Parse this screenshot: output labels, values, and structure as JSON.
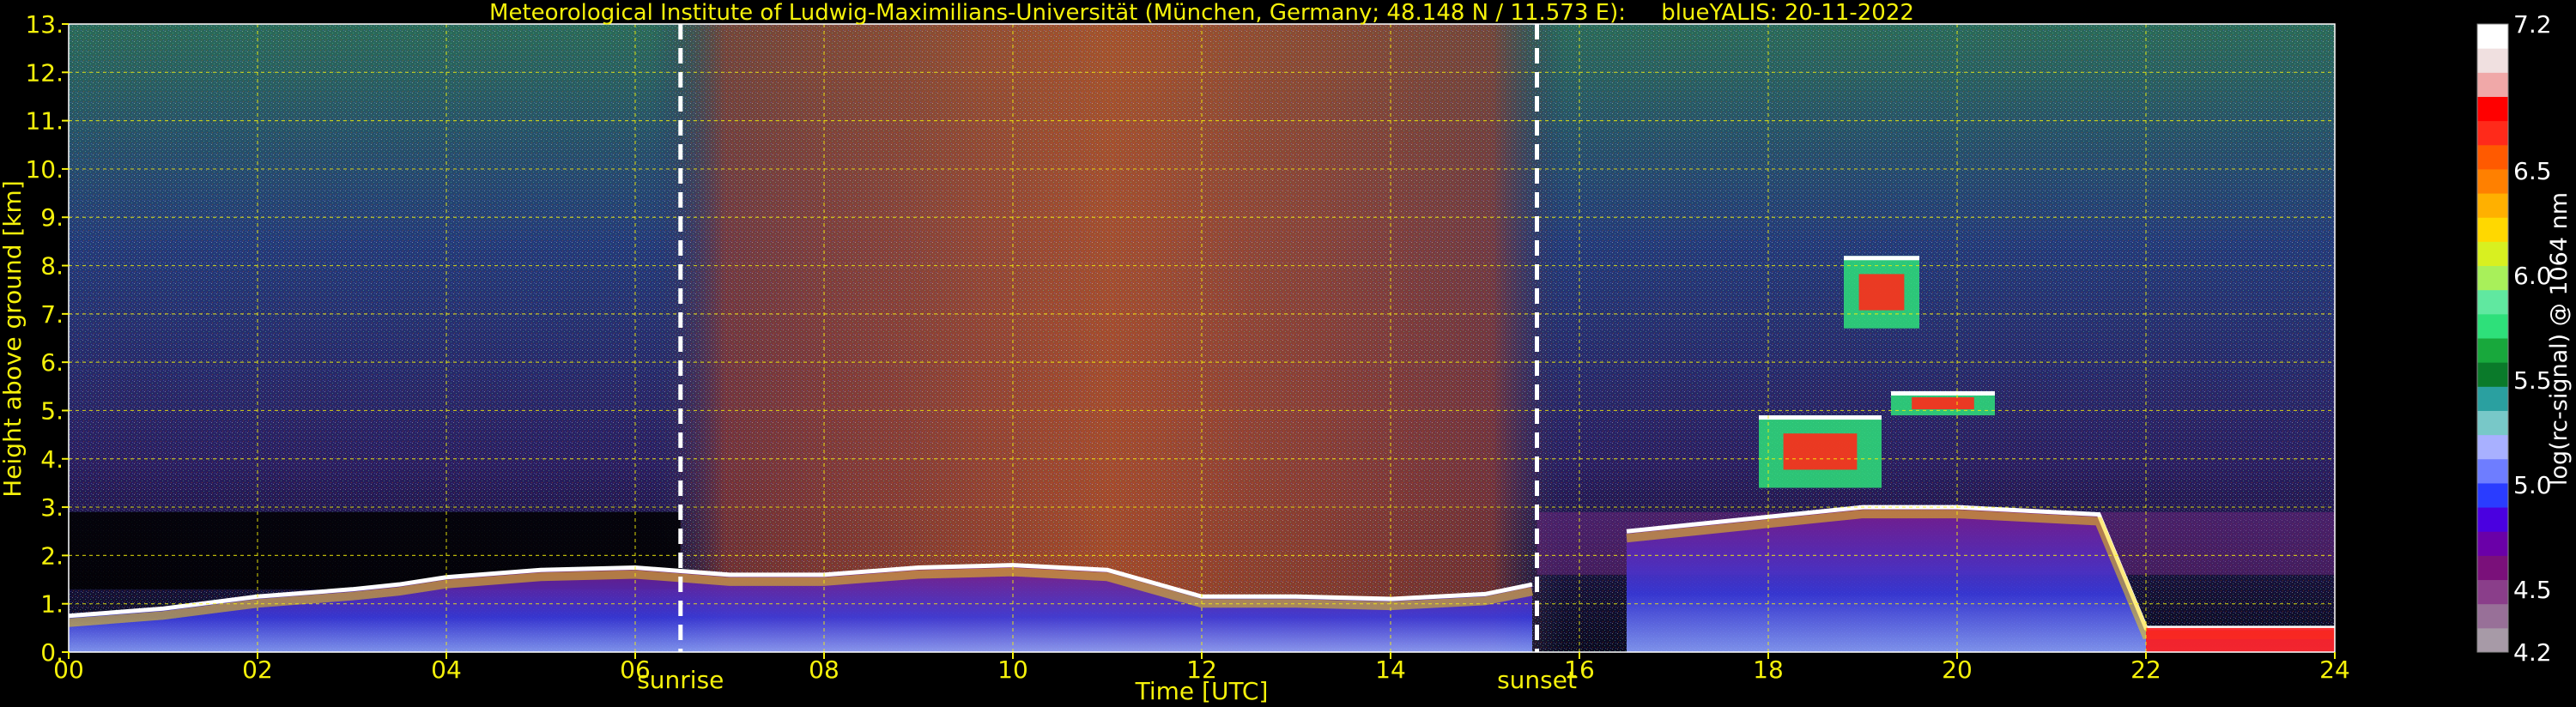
{
  "chart_data": {
    "type": "heatmap",
    "title": "Meteorological Institute of Ludwig-Maximilians-Universität (München, Germany; 48.148 N / 11.573 E):     blueYALIS: 20-11-2022",
    "xlabel": "Time [UTC]",
    "ylabel": "Height above ground [km]",
    "xlim": [
      0,
      24
    ],
    "ylim": [
      0,
      13
    ],
    "x_ticks": [
      "00",
      "02",
      "04",
      "06",
      "08",
      "10",
      "12",
      "14",
      "16",
      "18",
      "20",
      "22",
      "24"
    ],
    "y_ticks": [
      "0.",
      "1.",
      "2.",
      "3.",
      "4.",
      "5.",
      "6.",
      "7.",
      "8.",
      "9.",
      "10.",
      "11.",
      "12.",
      "13."
    ],
    "grid": true,
    "markers": [
      {
        "label": "sunrise",
        "x": 6.48
      },
      {
        "label": "sunset",
        "x": 15.55
      }
    ],
    "colorbar": {
      "label": "log(rc-signal) @ 1064 nm",
      "range": [
        4.2,
        7.2
      ],
      "ticks": [
        "4.2",
        "4.5",
        "5.0",
        "5.5",
        "6.0",
        "6.5",
        "7.2"
      ],
      "tick_values": [
        4.2,
        4.5,
        5.0,
        5.5,
        6.0,
        6.5,
        7.2
      ],
      "colors": [
        "#a79aa7",
        "#987098",
        "#8a3e8a",
        "#7a107a",
        "#6a00a8",
        "#4a00e0",
        "#2a3cff",
        "#6e7dff",
        "#a8b0ff",
        "#78c8c8",
        "#2aa0a0",
        "#0a7a2a",
        "#18a83c",
        "#2ee07a",
        "#60e8a0",
        "#a8f05a",
        "#d8f020",
        "#ffd800",
        "#ffb000",
        "#ff8000",
        "#ff5a00",
        "#ff2a1a",
        "#ff0000",
        "#f0a8a8",
        "#f0e0e0",
        "#ffffff"
      ]
    },
    "features": [
      {
        "name": "boundary layer top",
        "x": [
          0,
          1,
          2,
          3,
          3.5,
          4,
          5,
          6,
          7,
          8,
          9,
          10,
          11,
          12,
          13,
          14,
          15,
          15.5
        ],
        "y": [
          0.75,
          0.9,
          1.15,
          1.3,
          1.4,
          1.55,
          1.7,
          1.75,
          1.6,
          1.6,
          1.75,
          1.8,
          1.7,
          1.15,
          1.15,
          1.1,
          1.2,
          1.4
        ]
      },
      {
        "name": "elevated layer",
        "x": [
          16.5,
          17,
          18,
          19,
          20,
          21,
          21.5,
          22,
          23,
          24
        ],
        "y": [
          2.5,
          2.6,
          2.8,
          3.0,
          3.0,
          2.9,
          2.85,
          0.5,
          0.5,
          0.5
        ]
      },
      {
        "name": "cloud",
        "x": [
          17.9,
          19.2
        ],
        "y": [
          3.4,
          4.9
        ]
      },
      {
        "name": "cloud",
        "x": [
          19.3,
          20.4
        ],
        "y": [
          4.9,
          5.4
        ]
      },
      {
        "name": "cloud",
        "x": [
          18.8,
          19.6
        ],
        "y": [
          6.7,
          8.2
        ]
      }
    ]
  }
}
